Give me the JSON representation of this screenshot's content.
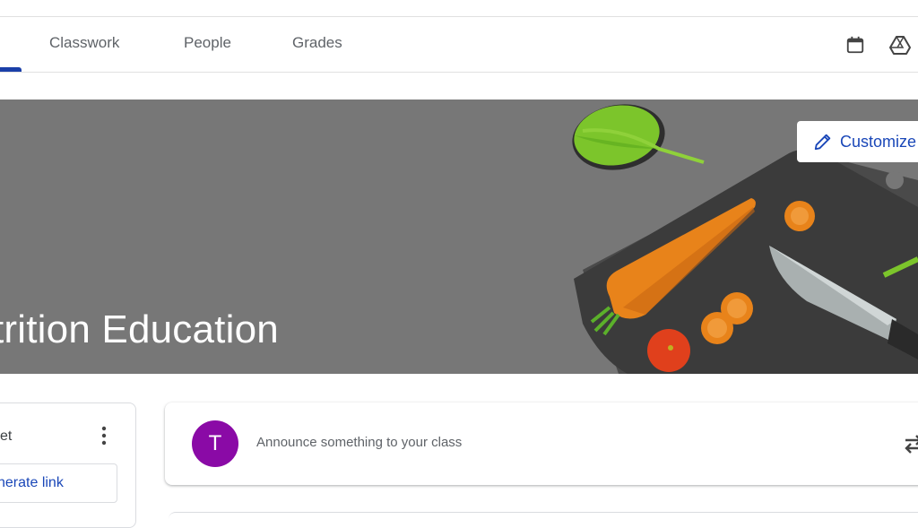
{
  "tabs": [
    {
      "label": "Classwork"
    },
    {
      "label": "People"
    },
    {
      "label": "Grades"
    }
  ],
  "header_icons": [
    "calendar-icon",
    "drive-icon"
  ],
  "banner": {
    "title": "trition Education",
    "customize_label": "Customize",
    "background_color": "#777777"
  },
  "side_card": {
    "label": "et",
    "link_button": "nerate link"
  },
  "announce": {
    "avatar_letter": "T",
    "avatar_color": "#8a0aa6",
    "placeholder": "Announce something to your class"
  },
  "colors": {
    "accent": "#1a47b8"
  }
}
